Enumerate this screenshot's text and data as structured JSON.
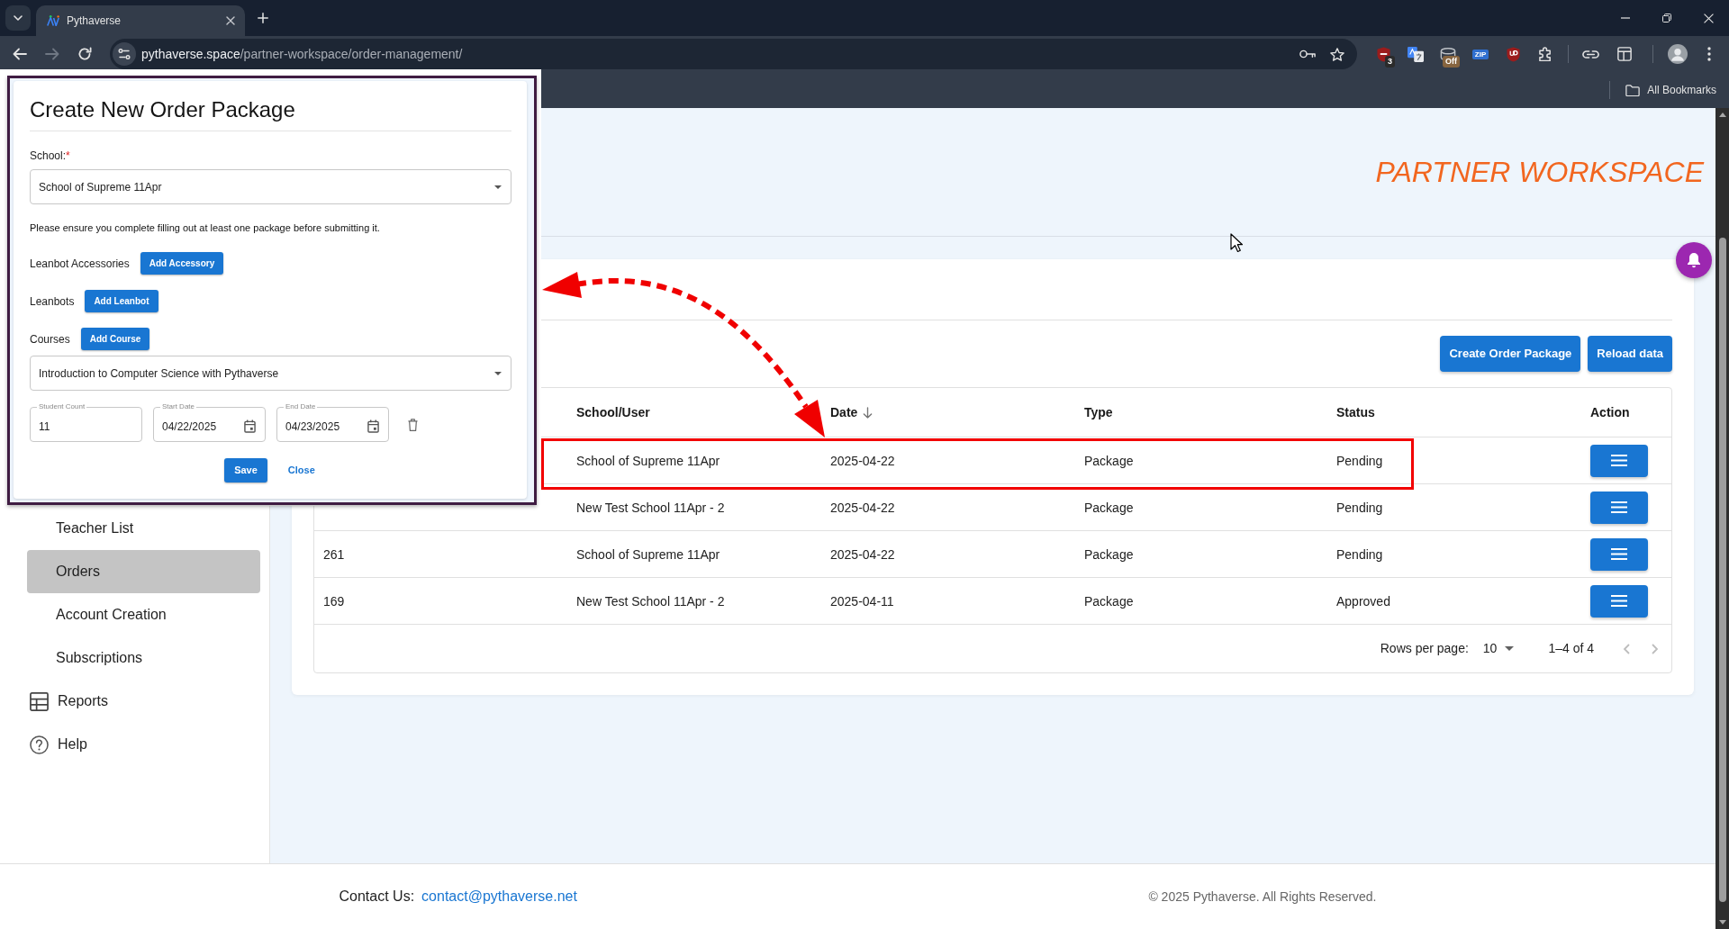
{
  "browser": {
    "tab": {
      "title": "Pythaverse"
    },
    "back": {
      "disabled": false
    },
    "forward": {
      "disabled": true
    },
    "address": {
      "host": "pythaverse.space",
      "path": "/partner-workspace/order-management/"
    },
    "extensions": [
      {
        "kind": "badge",
        "badge": "3"
      },
      {
        "kind": "plain"
      },
      {
        "kind": "badge",
        "badge": "Off"
      },
      {
        "kind": "chip",
        "label": "ZIP"
      },
      {
        "kind": "plain"
      },
      {
        "kind": "plain"
      }
    ],
    "bookmarks": {
      "label": "All Bookmarks"
    }
  },
  "dialog": {
    "title": "Create New Order Package",
    "school": {
      "label": "School:",
      "required_mark": "*",
      "value": "School of Supreme 11Apr"
    },
    "notice": "Please ensure you complete filling out at least one package before submitting it.",
    "sections": [
      {
        "label": "Leanbot Accessories",
        "button": "Add Accessory"
      },
      {
        "label": "Leanbots",
        "button": "Add Leanbot"
      },
      {
        "label": "Courses",
        "button": "Add Course"
      }
    ],
    "course": {
      "value": "Introduction to Computer Science with Pythaverse"
    },
    "package_fields": [
      {
        "kind": "number",
        "label": "Student Count",
        "value": "11"
      },
      {
        "kind": "date",
        "label": "Start Date",
        "value": "04/22/2025"
      },
      {
        "kind": "date",
        "label": "End Date",
        "value": "04/23/2025"
      }
    ],
    "buttons": [
      {
        "kind": "contained",
        "label": "Save"
      },
      {
        "kind": "text",
        "label": "Close"
      }
    ]
  },
  "header": {
    "title": "PARTNER WORKSPACE"
  },
  "sidebar": {
    "items": [
      {
        "label": "Teacher List",
        "kind": "subitem",
        "selected": false
      },
      {
        "label": "Orders",
        "kind": "subitem",
        "selected": true
      },
      {
        "label": "Account Creation",
        "kind": "subitem",
        "selected": false
      },
      {
        "label": "Subscriptions",
        "kind": "subitem",
        "selected": false
      },
      {
        "label": "Reports",
        "kind": "section",
        "selected": false
      },
      {
        "label": "Help",
        "kind": "section",
        "selected": false
      }
    ]
  },
  "actions": [
    {
      "label": "Create Order Package"
    },
    {
      "label": "Reload data"
    }
  ],
  "table": {
    "columns": [
      {
        "label": "School/User",
        "sorted": false
      },
      {
        "label": "Date",
        "sorted": true
      },
      {
        "label": "Type",
        "sorted": false
      },
      {
        "label": "Status",
        "sorted": false
      },
      {
        "label": "Action",
        "sorted": false
      }
    ],
    "rows": [
      {
        "school_user": "School of Supreme 11Apr",
        "date": "2025-04-22",
        "type": "Package",
        "status": "Pending",
        "highlighted": true
      },
      {
        "school_user": "New Test School 11Apr - 2",
        "date": "2025-04-22",
        "type": "Package",
        "status": "Pending",
        "highlighted": false
      },
      {
        "id": "261",
        "school_user": "School of Supreme 11Apr",
        "date": "2025-04-22",
        "type": "Package",
        "status": "Pending",
        "highlighted": false
      },
      {
        "id": "169",
        "school_user": "New Test School 11Apr - 2",
        "date": "2025-04-11",
        "type": "Package",
        "status": "Approved",
        "highlighted": false
      }
    ],
    "pagination": {
      "rows_per_page_label": "Rows per page:",
      "rows_per_page": "10",
      "range": "1–4 of 4",
      "previous": {
        "disabled": true
      },
      "next": {
        "disabled": true
      }
    }
  },
  "footer": {
    "contact_label": "Contact Us:",
    "email": "contact@pythaverse.net",
    "copyright": "© 2025 Pythaverse. All Rights Reserved."
  }
}
